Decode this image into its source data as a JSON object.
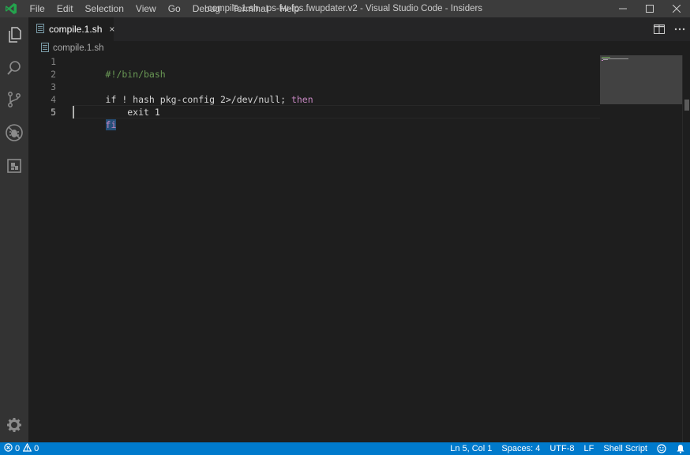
{
  "menu": [
    "File",
    "Edit",
    "Selection",
    "View",
    "Go",
    "Debug",
    "Terminal",
    "Help"
  ],
  "window_title": "compile.1.sh - ps-fw-fps.fwupdater.v2 - Visual Studio Code - Insiders",
  "tab": {
    "label": "compile.1.sh",
    "close": "×"
  },
  "breadcrumb": {
    "file": "compile.1.sh"
  },
  "editor": {
    "line_numbers": [
      "1",
      "2",
      "3",
      "4",
      "5"
    ],
    "lines": {
      "l1": "#!/bin/bash",
      "l3a": "if ! hash pkg-config 2>/dev/null; ",
      "l3b": "then",
      "l4": "    exit 1",
      "l5": "fi"
    }
  },
  "status": {
    "errors": "0",
    "warnings": "0",
    "position": "Ln 5, Col 1",
    "spaces": "Spaces: 4",
    "encoding": "UTF-8",
    "eol": "LF",
    "language": "Shell Script"
  },
  "icons": {
    "app": "vscode-insiders-icon",
    "explorer": "files-icon",
    "search": "search-icon",
    "scm": "source-control-icon",
    "debug": "debug-icon",
    "extensions": "extensions-icon",
    "settings": "gear-icon"
  },
  "colors": {
    "accent": "#007acc",
    "activitybar": "#333333",
    "titlebar": "#3c3c3c",
    "editor_bg": "#1e1e1e",
    "comment": "#6a9955",
    "keyword": "#c586c0"
  }
}
